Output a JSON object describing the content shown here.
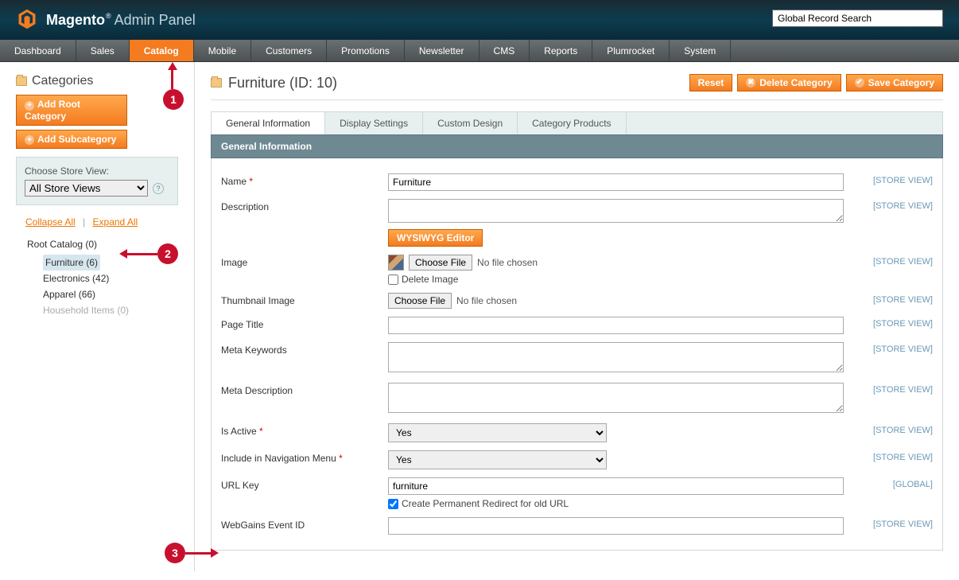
{
  "header": {
    "brand": "Magento",
    "subtitle": "Admin Panel",
    "search_placeholder": "Global Record Search"
  },
  "nav": {
    "items": [
      "Dashboard",
      "Sales",
      "Catalog",
      "Mobile",
      "Customers",
      "Promotions",
      "Newsletter",
      "CMS",
      "Reports",
      "Plumrocket",
      "System"
    ],
    "active_index": 2
  },
  "sidebar": {
    "title": "Categories",
    "add_root": "Add Root Category",
    "add_sub": "Add Subcategory",
    "store_label": "Choose Store View:",
    "store_selected": "All Store Views",
    "collapse": "Collapse All",
    "expand": "Expand All",
    "tree": {
      "root": "Root Catalog (0)",
      "items": [
        {
          "label": "Furniture (6)",
          "selected": true
        },
        {
          "label": "Electronics (42)",
          "selected": false
        },
        {
          "label": "Apparel (66)",
          "selected": false
        },
        {
          "label": "Household Items (0)",
          "selected": false,
          "disabled": true
        }
      ]
    }
  },
  "page": {
    "title": "Furniture (ID: 10)",
    "reset": "Reset",
    "delete": "Delete Category",
    "save": "Save Category"
  },
  "tabs": {
    "items": [
      "General Information",
      "Display Settings",
      "Custom Design",
      "Category Products"
    ],
    "active_index": 0
  },
  "section": {
    "title": "General Information"
  },
  "form": {
    "name_label": "Name",
    "name_value": "Furniture",
    "description_label": "Description",
    "wysiwyg": "WYSIWYG Editor",
    "image_label": "Image",
    "choose_file": "Choose File",
    "no_file": "No file chosen",
    "delete_image": "Delete Image",
    "thumb_label": "Thumbnail Image",
    "page_title_label": "Page Title",
    "meta_kw_label": "Meta Keywords",
    "meta_desc_label": "Meta Description",
    "active_label": "Is Active",
    "active_value": "Yes",
    "nav_label": "Include in Navigation Menu",
    "nav_value": "Yes",
    "urlkey_label": "URL Key",
    "urlkey_value": "furniture",
    "redirect_label": "Create Permanent Redirect for old URL",
    "webgains_label": "WebGains Event ID",
    "scope_store": "[STORE VIEW]",
    "scope_global": "[GLOBAL]"
  },
  "annotations": {
    "a1": "1",
    "a2": "2",
    "a3": "3"
  }
}
